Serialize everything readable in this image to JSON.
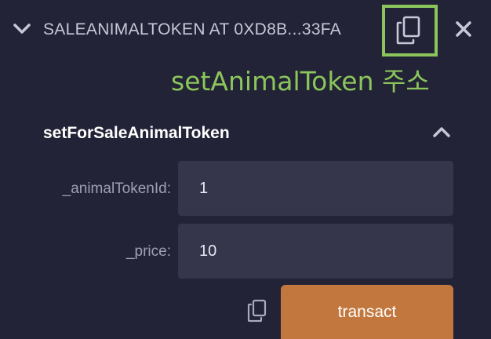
{
  "header": {
    "title": "SALEANIMALTOKEN AT 0XD8B...33FA",
    "copy_icon": "copy-icon",
    "close_icon": "close-icon",
    "expand_icon": "chevron-down-icon"
  },
  "annotation": {
    "text": "setAnimalToken 주소",
    "color": "#8cc55b"
  },
  "function": {
    "name": "setForSaleAnimalToken",
    "collapse_icon": "chevron-up-icon",
    "params": [
      {
        "label": "_animalTokenId:",
        "value": "1"
      },
      {
        "label": "_price:",
        "value": "10"
      }
    ],
    "transact_label": "transact",
    "transact_color": "#c2773f"
  },
  "colors": {
    "background": "#222336",
    "input_background": "#35364c",
    "highlight": "#8cc55b"
  }
}
